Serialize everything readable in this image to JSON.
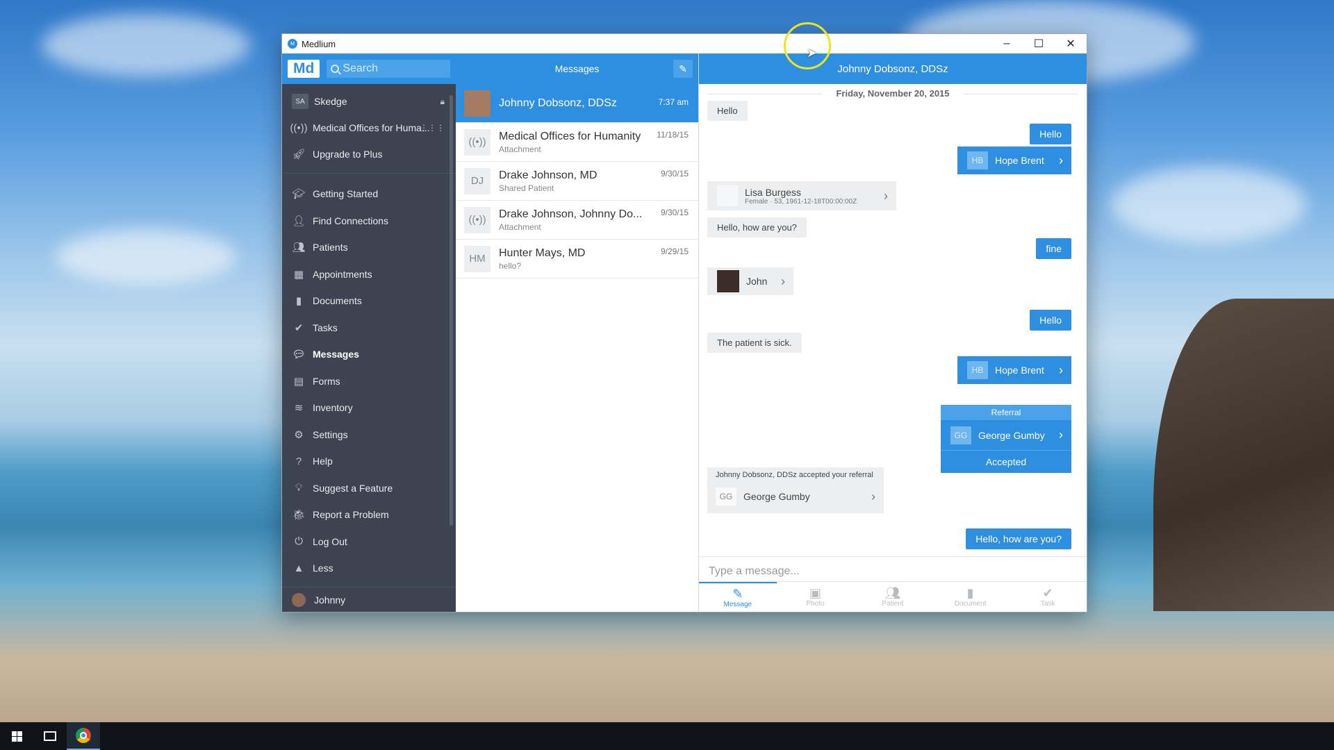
{
  "window": {
    "title": "Medlium"
  },
  "nav": {
    "logo": "Md",
    "search_placeholder": "Search",
    "top_items": [
      {
        "badge": "SA",
        "label": "Skedge",
        "icon": "lock-icon"
      },
      {
        "label": "Medical Offices for Huma...",
        "icon": "broadcast-icon"
      },
      {
        "label": "Upgrade to Plus",
        "icon": "rocket-icon"
      }
    ],
    "items": [
      {
        "label": "Getting Started",
        "icon": "graduation-cap-icon"
      },
      {
        "label": "Find Connections",
        "icon": "add-person-icon"
      },
      {
        "label": "Patients",
        "icon": "patient-icon"
      },
      {
        "label": "Appointments",
        "icon": "calendar-icon"
      },
      {
        "label": "Documents",
        "icon": "document-icon"
      },
      {
        "label": "Tasks",
        "icon": "check-circle-icon"
      },
      {
        "label": "Messages",
        "icon": "chat-bubbles-icon",
        "active": true
      },
      {
        "label": "Forms",
        "icon": "form-icon"
      },
      {
        "label": "Inventory",
        "icon": "stack-icon"
      },
      {
        "label": "Settings",
        "icon": "gear-icon"
      },
      {
        "label": "Help",
        "icon": "question-icon"
      },
      {
        "label": "Suggest a Feature",
        "icon": "bulb-icon"
      },
      {
        "label": "Report a Problem",
        "icon": "bug-icon"
      },
      {
        "label": "Log Out",
        "icon": "power-icon"
      },
      {
        "label": "Less",
        "icon": "triangle-up-icon"
      }
    ],
    "user": "Johnny"
  },
  "list": {
    "title": "Messages",
    "conversations": [
      {
        "name": "Johnny Dobsonz, DDSz",
        "time": "7:37 am",
        "sub": "",
        "avatar": "",
        "active": true
      },
      {
        "name": "Medical Offices for Humanity",
        "time": "11/18/15",
        "sub": "Attachment",
        "avatar": "((•))"
      },
      {
        "name": "Drake Johnson, MD",
        "time": "9/30/15",
        "sub": "Shared Patient",
        "avatar": "DJ"
      },
      {
        "name": "Drake Johnson, Johnny Do...",
        "time": "9/30/15",
        "sub": "Attachment",
        "avatar": "((•))"
      },
      {
        "name": "Hunter Mays, MD",
        "time": "9/29/15",
        "sub": "hello?",
        "avatar": "HM"
      }
    ]
  },
  "chat": {
    "title": "Johnny Dobsonz, DDSz",
    "date": "Friday, November 20, 2015",
    "m1": "Hello",
    "m2": "Hello",
    "m3_initials": "HB",
    "m3_name": "Hope Brent",
    "m4_name": "Lisa Burgess",
    "m4_sub": "Female · 53, 1961-12-18T00:00:00Z",
    "m5": "Hello, how are you?",
    "m6": "fine",
    "m7_name": "John",
    "m8": "Hello",
    "m9": "The patient is sick.",
    "m10_initials": "HB",
    "m10_name": "Hope Brent",
    "ref_title": "Referral",
    "ref_initials": "GG",
    "ref_name": "George Gumby",
    "ref_status": "Accepted",
    "acc_note": "Johnny Dobsonz, DDSz accepted your referral",
    "acc_initials": "GG",
    "acc_name": "George Gumby",
    "m12": "Hello, how are you?",
    "composer_placeholder": "Type a message...",
    "tabs": [
      "Message",
      "Photo",
      "Patient",
      "Document",
      "Task"
    ]
  },
  "colors": {
    "accent": "#2e8fe0",
    "nav_bg": "#3d4350"
  }
}
